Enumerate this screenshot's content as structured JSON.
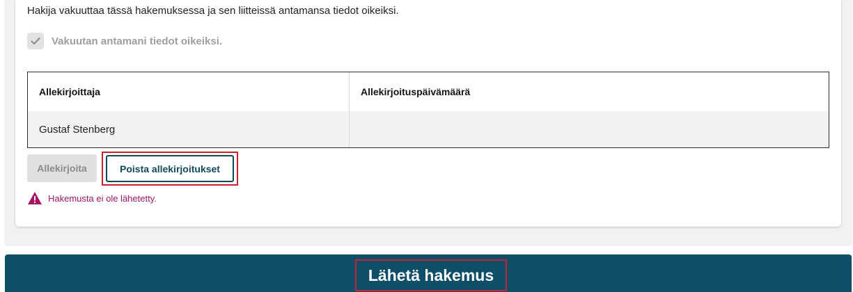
{
  "declaration_text": "Hakija vakuuttaa tässä hakemuksessa ja sen liitteissä antamansa tiedot oikeiksi.",
  "confirm_checkbox": {
    "label": "Vakuutan antamani tiedot oikeiksi.",
    "checked": true
  },
  "signatures_table": {
    "headers": [
      "Allekirjoittaja",
      "Allekirjoituspäivämäärä"
    ],
    "rows": [
      [
        "Gustaf Stenberg",
        ""
      ]
    ]
  },
  "buttons": {
    "sign_label": "Allekirjoita",
    "remove_signatures_label": "Poista allekirjoitukset",
    "submit_label": "Lähetä hakemus"
  },
  "warning": {
    "icon": "warning-triangle-icon",
    "text": "Hakemusta ei ole lähetetty."
  },
  "colors": {
    "brand": "#0d4f68",
    "warning": "#a31564",
    "highlight": "#d0202e"
  }
}
